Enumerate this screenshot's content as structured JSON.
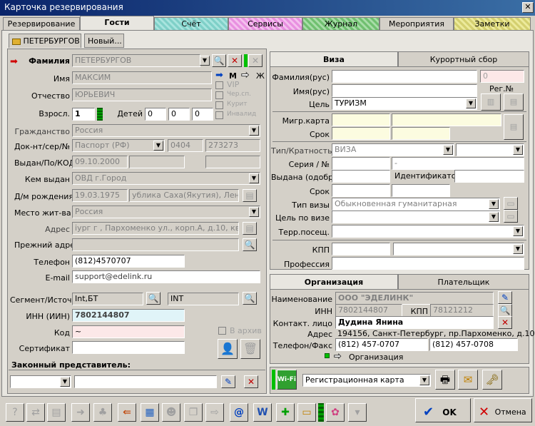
{
  "window": {
    "title": "Карточка резервирования",
    "close": "✕"
  },
  "tabs": [
    {
      "label": "Резервирование"
    },
    {
      "label": "Гости"
    },
    {
      "label": "Счёт"
    },
    {
      "label": "Сервисы"
    },
    {
      "label": "Журнал"
    },
    {
      "label": "Мероприятия"
    },
    {
      "label": "Заметки"
    }
  ],
  "guest_tabs": {
    "current": "ПЕТЕРБУРГОВ",
    "new": "Новый..."
  },
  "guest": {
    "surname_label": "Фамилия",
    "surname": "ПЕТЕРБУРГОВ",
    "name_label": "Имя",
    "name": "МАКСИМ",
    "patronymic_label": "Отчество",
    "patronymic": "ЮРЬЕВИЧ",
    "adults_label": "Взросл.",
    "adults": "1",
    "children_label": "Детей",
    "children1": "0",
    "children2": "0",
    "children3": "0",
    "gender_m": "М",
    "gender_f": "Ж",
    "vip": "VIP",
    "checkbox2": "Чер.сп.",
    "checkbox3": "Курит",
    "checkbox4": "Инвалид",
    "citizenship_label": "Гражданство",
    "citizenship": "Россия",
    "doc_label": "Док-нт/сер/№",
    "doc_type": "Паспорт (РФ)",
    "doc_series": "0404",
    "doc_number": "273273",
    "issued_label": "Выдан/По/КОД",
    "issued_date": "09.10.2000",
    "issued_by_label": "Кем выдан",
    "issued_by": "ОВД г.Город",
    "birth_label": "Д/м рождения",
    "birth_date": "19.03.1975",
    "birth_place": "ублика Саха(Якутия), Ленски",
    "residence_label": "Место жит-ва",
    "residence": "Россия",
    "address_label": "Адрес",
    "address": "іург г , Пархоменко ул., корп.А, д.10, кв.оф.2",
    "prev_address_label": "Прежний адрес",
    "phone_label": "Телефон",
    "phone": "(812)4570707",
    "email_label": "E-mail",
    "email": "support@edelink.ru",
    "segment_label": "Сегмент/Источ.",
    "segment": "Int,БТ",
    "source": "INT",
    "inn_label": "ИНН (ИИН)",
    "inn": "7802144807",
    "code_label": "Код",
    "code": "~",
    "archive_label": "В архив",
    "cert_label": "Сертификат",
    "legal_rep_label": "Законный представитель:"
  },
  "visa_tabs": {
    "visa": "Виза",
    "resort_fee": "Курортный сбор"
  },
  "visa": {
    "surname_rus_label": "Фамилия(рус)",
    "name_rus_label": "Имя(рус)",
    "reg_number": "0",
    "reg_label": "Рег.№",
    "purpose_label": "Цель",
    "purpose": "ТУРИЗМ",
    "migr_label": "Мигр.карта",
    "term_label": "Срок",
    "type_label": "Тип/Кратность",
    "type": "ВИЗА",
    "series_label": "Серия / №",
    "series_dash": "-",
    "issued_label": "Выдана (одобр)",
    "identifier_label": "Идентификатор",
    "term2_label": "Срок",
    "visa_type_label": "Тип визы",
    "visa_type": "Обыкновенная гуманитарная",
    "visa_purpose_label": "Цель по визе",
    "territory_label": "Терр.посещ.",
    "kpp_label": "КПП",
    "profession_label": "Профессия"
  },
  "org_tabs": {
    "org": "Организация",
    "payer": "Плательщик"
  },
  "org": {
    "name_label": "Наименование",
    "name": "ООО \"ЭДЕЛИНК\"",
    "inn_label": "ИНН",
    "inn": "7802144807",
    "kpp_label": "КПП",
    "kpp": "78121212",
    "contact_label": "Контакт. лицо",
    "contact": "Дудина Янина",
    "address_label": "Адрес",
    "address": "194156, Санкт-Петербург, пр.Пархоменко, д.10",
    "phone_label": "Телефон/Факс",
    "phone": "(812) 457-0707",
    "fax": "(812) 457-0708",
    "org_link": "Организация"
  },
  "bottom": {
    "reg_card": "Регистрационная карта",
    "ok": "OK",
    "cancel": "Отмена"
  }
}
